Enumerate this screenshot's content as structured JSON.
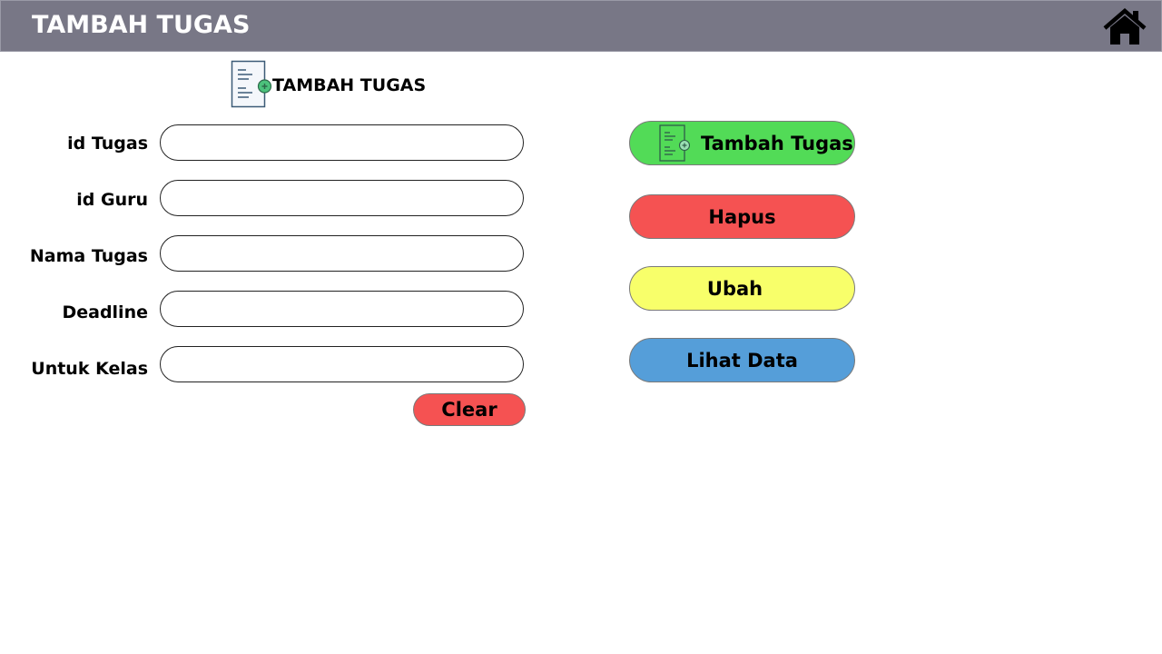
{
  "header": {
    "title": "TAMBAH TUGAS",
    "home_icon": "home-icon"
  },
  "form": {
    "heading": "TAMBAH TUGAS",
    "heading_icon": "document-add-icon",
    "fields": [
      {
        "label": "id Tugas",
        "value": "",
        "placeholder": ""
      },
      {
        "label": "id Guru",
        "value": "",
        "placeholder": ""
      },
      {
        "label": "Nama Tugas",
        "value": "",
        "placeholder": ""
      },
      {
        "label": "Deadline",
        "value": "",
        "placeholder": ""
      },
      {
        "label": "Untuk Kelas",
        "value": "",
        "placeholder": ""
      }
    ],
    "clear_label": "Clear"
  },
  "actions": {
    "tambah_label": "Tambah Tugas",
    "hapus_label": "Hapus",
    "ubah_label": "Ubah",
    "lihat_label": "Lihat Data"
  },
  "colors": {
    "header_bg": "#787786",
    "green": "#52db57",
    "red": "#f55252",
    "yellow": "#f8ff6a",
    "blue": "#559ed9"
  }
}
